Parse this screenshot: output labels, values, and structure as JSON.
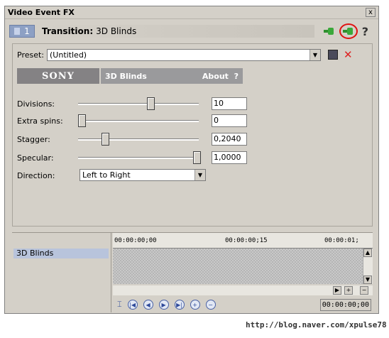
{
  "window": {
    "title": "Video Event FX",
    "close_label": "x"
  },
  "header": {
    "chain_number": "1",
    "transition_prefix": "Transition:",
    "transition_name": "3D Blinds",
    "help_label": "?"
  },
  "preset": {
    "label": "Preset:",
    "value": "(Untitled)"
  },
  "banner": {
    "brand": "SONY",
    "plugin_name": "3D Blinds",
    "about_label": "About",
    "about_q": "?"
  },
  "params": [
    {
      "label": "Divisions:",
      "value": "10",
      "level": 0.6
    },
    {
      "label": "Extra spins:",
      "value": "0",
      "level": 0.0
    },
    {
      "label": "Stagger:",
      "value": "0,2040",
      "level": 0.204
    },
    {
      "label": "Specular:",
      "value": "1,0000",
      "level": 1.0
    }
  ],
  "direction": {
    "label": "Direction:",
    "value": "Left to Right"
  },
  "fx_list": {
    "items": [
      "3D Blinds"
    ]
  },
  "timeline": {
    "ticks": [
      "00:00:00;00",
      "00:00:00;15",
      "00:00:01;"
    ],
    "timecode": "00:00:00;00"
  },
  "watermark": "http://blog.naver.com/xpulse78"
}
